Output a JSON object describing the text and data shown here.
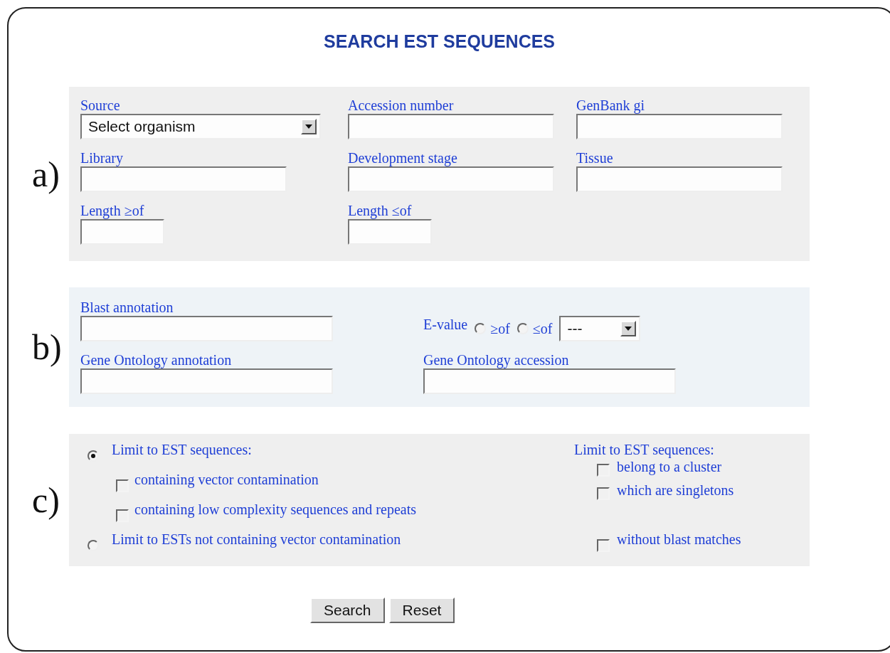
{
  "title": "SEARCH EST SEQUENCES",
  "section_a": {
    "marker": "a)",
    "fields": [
      {
        "kind": "select",
        "label": "Source",
        "value": "Select organism"
      },
      {
        "kind": "text",
        "label": "Accession number"
      },
      {
        "kind": "text",
        "label": "GenBank gi"
      },
      {
        "kind": "text",
        "label": "Library"
      },
      {
        "kind": "text",
        "label": "Development stage"
      },
      {
        "kind": "text",
        "label": "Tissue"
      },
      {
        "kind": "short",
        "label": "Length ≥of"
      },
      {
        "kind": "short",
        "label": "Length ≤of"
      }
    ]
  },
  "section_b": {
    "marker": "b)",
    "blast_annotation": {
      "label": "Blast annotation"
    },
    "evalue": {
      "label": "E-value",
      "options": [
        {
          "label": "≥of",
          "selected": false
        },
        {
          "label": "≤of",
          "selected": false
        }
      ],
      "select_value": "---"
    },
    "go_annotation": {
      "label": "Gene Ontology annotation"
    },
    "go_accession": {
      "label": "Gene Ontology accession"
    }
  },
  "section_c": {
    "marker": "c)",
    "left": [
      {
        "kind": "radio",
        "label": "Limit to EST sequences:",
        "selected": true
      },
      {
        "kind": "checkbox",
        "label": "containing vector contamination",
        "checked": false
      },
      {
        "kind": "checkbox",
        "label": "containing low complexity sequences and repeats",
        "checked": false
      },
      {
        "kind": "radio",
        "label": "Limit to ESTs not containing vector contamination",
        "selected": false
      }
    ],
    "right_heading": "Limit to EST sequences:",
    "right": [
      {
        "label": "belong to a cluster",
        "checked": false
      },
      {
        "label": "which are singletons",
        "checked": false
      },
      {
        "label": "without blast matches",
        "checked": false
      }
    ]
  },
  "buttons": [
    "Search",
    "Reset"
  ]
}
